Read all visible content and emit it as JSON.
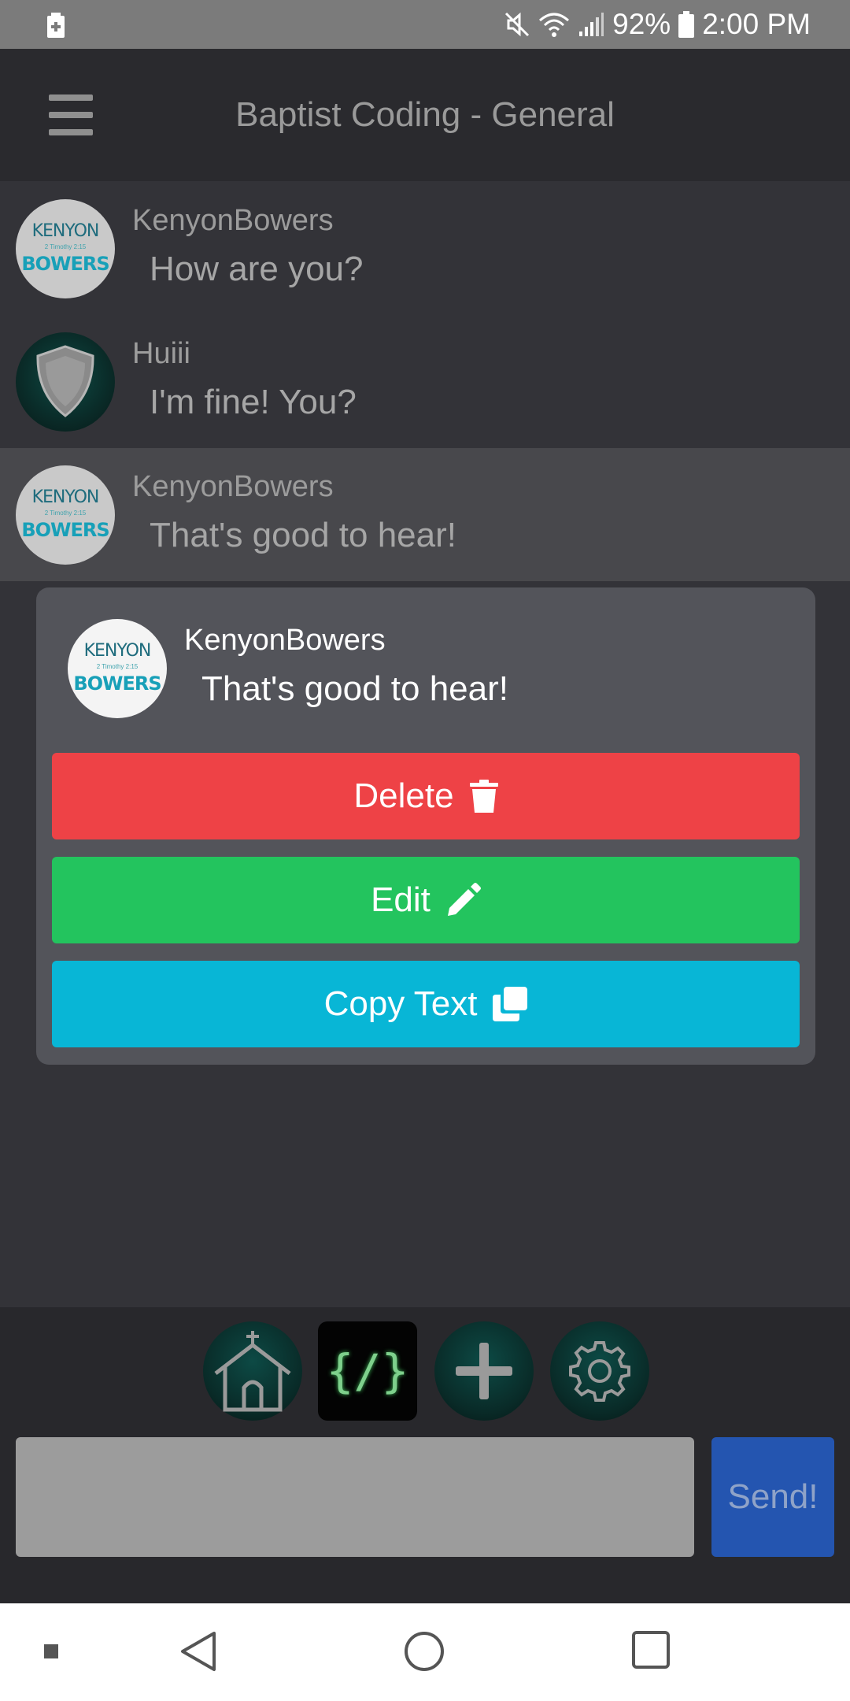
{
  "status_bar": {
    "battery_percent": "92%",
    "time": "2:00 PM",
    "icons": [
      "battery-saver-icon",
      "mute-icon",
      "wifi-icon",
      "signal-icon",
      "battery-icon"
    ]
  },
  "header": {
    "title": "Baptist Coding - General"
  },
  "avatars": {
    "kenyon": {
      "line1": "KENYON",
      "line2": "2 Timothy 2:15",
      "line3": "BOWERS"
    }
  },
  "messages": [
    {
      "user": "KenyonBowers",
      "text": "How are you?",
      "avatar": "kenyon"
    },
    {
      "user": "Huiii",
      "text": "I'm fine! You?",
      "avatar": "shield"
    },
    {
      "user": "KenyonBowers",
      "text": "That's good to hear!",
      "avatar": "kenyon",
      "selected": true
    }
  ],
  "popup": {
    "user": "KenyonBowers",
    "text": "That's good to hear!",
    "delete_label": "Delete",
    "edit_label": "Edit",
    "copy_label": "Copy Text"
  },
  "toolbar": {
    "icons": [
      "church-icon",
      "code-icon",
      "plus-icon",
      "gear-icon"
    ],
    "code_glyph": "{/}"
  },
  "composer": {
    "input_value": "",
    "input_placeholder": "",
    "send_label": "Send!"
  },
  "colors": {
    "delete": "#ee4246",
    "edit": "#23c45e",
    "copy": "#08b6d6",
    "send": "#2455b0"
  }
}
